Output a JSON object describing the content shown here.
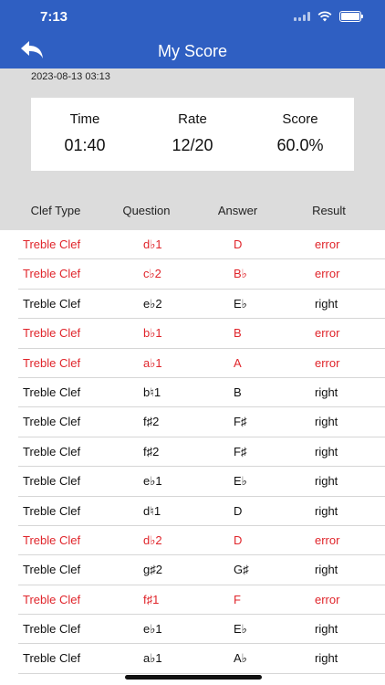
{
  "status_bar": {
    "time": "7:13"
  },
  "header": {
    "title": "My Score"
  },
  "summary": {
    "date": "2023-08-13 03:13",
    "stats": [
      {
        "label": "Time",
        "value": "01:40"
      },
      {
        "label": "Rate",
        "value": "12/20"
      },
      {
        "label": "Score",
        "value": "60.0%"
      }
    ]
  },
  "table": {
    "columns": [
      "Clef Type",
      "Question",
      "Answer",
      "Result"
    ],
    "error_color": "#e0252b",
    "rows": [
      {
        "clef": "Treble Clef",
        "question": "d♭1",
        "answer": "D",
        "result": "error"
      },
      {
        "clef": "Treble Clef",
        "question": "c♭2",
        "answer": "B♭",
        "result": "error"
      },
      {
        "clef": "Treble Clef",
        "question": "e♭2",
        "answer": "E♭",
        "result": "right"
      },
      {
        "clef": "Treble Clef",
        "question": "b♭1",
        "answer": "B",
        "result": "error"
      },
      {
        "clef": "Treble Clef",
        "question": "a♭1",
        "answer": "A",
        "result": "error"
      },
      {
        "clef": "Treble Clef",
        "question": "b♮1",
        "answer": "B",
        "result": "right"
      },
      {
        "clef": "Treble Clef",
        "question": "f♯2",
        "answer": "F♯",
        "result": "right"
      },
      {
        "clef": "Treble Clef",
        "question": "f♯2",
        "answer": "F♯",
        "result": "right"
      },
      {
        "clef": "Treble Clef",
        "question": "e♭1",
        "answer": "E♭",
        "result": "right"
      },
      {
        "clef": "Treble Clef",
        "question": "d♮1",
        "answer": "D",
        "result": "right"
      },
      {
        "clef": "Treble Clef",
        "question": "d♭2",
        "answer": "D",
        "result": "error"
      },
      {
        "clef": "Treble Clef",
        "question": "g♯2",
        "answer": "G♯",
        "result": "right"
      },
      {
        "clef": "Treble Clef",
        "question": "f♯1",
        "answer": "F",
        "result": "error"
      },
      {
        "clef": "Treble Clef",
        "question": "e♭1",
        "answer": "E♭",
        "result": "right"
      },
      {
        "clef": "Treble Clef",
        "question": "a♭1",
        "answer": "A♭",
        "result": "right"
      }
    ]
  }
}
